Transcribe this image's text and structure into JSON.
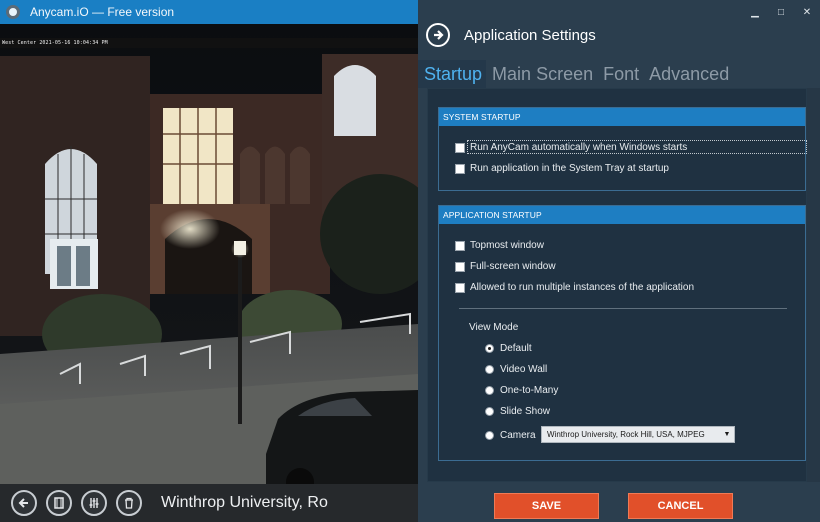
{
  "app": {
    "title": "Anycam.iO — Free version",
    "camera_timestamp": "West Center 2021-05-16 10:04:34 PM",
    "caption": "Winthrop University, Ro",
    "controls": {
      "back_icon": "arrow-left-icon",
      "film_icon": "film-icon",
      "sliders_icon": "sliders-icon",
      "trash_icon": "trash-icon"
    }
  },
  "window": {
    "minimize": "▁",
    "maximize": "□",
    "close": "✕"
  },
  "settings": {
    "title": "Application Settings",
    "tabs": [
      "Startup",
      "Main Screen",
      "Font",
      "Advanced"
    ],
    "active_tab": "Startup",
    "system_startup": {
      "header": "SYSTEM STARTUP",
      "options": [
        {
          "label": "Run AnyCam automatically when Windows starts",
          "checked": false
        },
        {
          "label": "Run application in the System Tray at startup",
          "checked": false
        }
      ]
    },
    "application_startup": {
      "header": "APPLICATION STARTUP",
      "options": [
        {
          "label": "Topmost window",
          "checked": false
        },
        {
          "label": "Full-screen window",
          "checked": false
        },
        {
          "label": "Allowed to run multiple instances of the application",
          "checked": false
        }
      ],
      "view_mode_label": "View Mode",
      "view_modes": [
        {
          "label": "Default",
          "selected": true
        },
        {
          "label": "Video Wall",
          "selected": false
        },
        {
          "label": "One-to-Many",
          "selected": false
        },
        {
          "label": "Slide Show",
          "selected": false
        },
        {
          "label": "Camera",
          "selected": false
        }
      ],
      "camera_select_value": "Winthrop University, Rock Hill, USA, MJPEG"
    },
    "buttons": {
      "save": "SAVE",
      "cancel": "CANCEL"
    }
  },
  "colors": {
    "accent_blue": "#1e7ec2",
    "tab_active": "#4fb2ef",
    "button_orange": "#e1502a",
    "panel_bg": "#2b3e4e"
  }
}
